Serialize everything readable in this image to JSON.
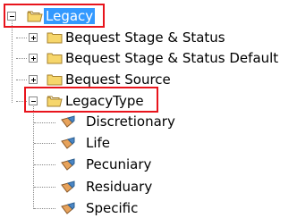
{
  "tree": {
    "root": {
      "label": "Legacy",
      "expanded": true,
      "selected": true,
      "icon": "folder-open-icon"
    },
    "children": [
      {
        "label": "Bequest Stage & Status",
        "expanded": false,
        "icon": "folder-icon"
      },
      {
        "label": "Bequest Stage & Status Default",
        "expanded": false,
        "icon": "folder-icon"
      },
      {
        "label": "Bequest Source",
        "expanded": false,
        "icon": "folder-icon"
      },
      {
        "label": "LegacyType",
        "expanded": true,
        "icon": "folder-open-icon",
        "children": [
          {
            "label": "Discretionary",
            "icon": "leaf-item-icon"
          },
          {
            "label": "Life",
            "icon": "leaf-item-icon"
          },
          {
            "label": "Pecuniary",
            "icon": "leaf-item-icon"
          },
          {
            "label": "Residuary",
            "icon": "leaf-item-icon"
          },
          {
            "label": "Specific",
            "icon": "leaf-item-icon"
          }
        ]
      }
    ]
  },
  "annotation_color": "#e8141c",
  "selection_color": "#3399ff"
}
